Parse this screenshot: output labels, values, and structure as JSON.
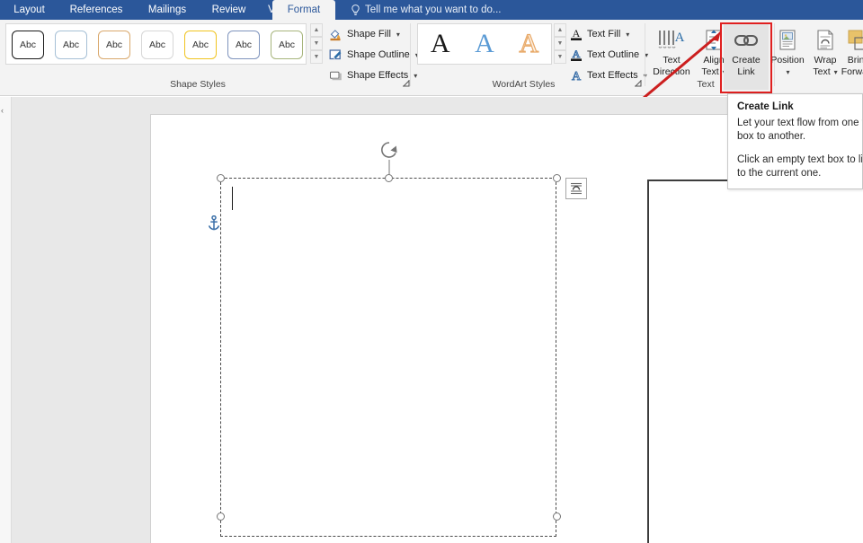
{
  "app": {
    "accent_color": "#2b579a",
    "ribbon_bg": "#f3f3f3",
    "workspace_bg": "#e8e8e8",
    "highlight_color": "#e02020"
  },
  "tabs": [
    {
      "label": "Layout",
      "active": false
    },
    {
      "label": "References",
      "active": false
    },
    {
      "label": "Mailings",
      "active": false
    },
    {
      "label": "Review",
      "active": false
    },
    {
      "label": "View",
      "active": false
    },
    {
      "label": "Format",
      "active": true
    }
  ],
  "tell_me": {
    "placeholder": "Tell me what you want to do...",
    "icon": "lightbulb-icon"
  },
  "groups": [
    {
      "label": "Shape Styles"
    },
    {
      "label": "WordArt Styles"
    },
    {
      "label": "Text"
    }
  ],
  "shape_styles": {
    "gallery_label": "Shape Styles",
    "items": [
      {
        "text": "Abc",
        "border": "#1a1a1a",
        "fill": "#ffffff",
        "selected": true
      },
      {
        "text": "Abc",
        "border": "#a6c0d6",
        "fill": "#ffffff",
        "selected": false
      },
      {
        "text": "Abc",
        "border": "#d9a86c",
        "fill": "#ffffff",
        "selected": false
      },
      {
        "text": "Abc",
        "border": "#d7d7d7",
        "fill": "#ffffff",
        "selected": false
      },
      {
        "text": "Abc",
        "border": "#f0c420",
        "fill": "#ffffff",
        "selected": false
      },
      {
        "text": "Abc",
        "border": "#7f94bd",
        "fill": "#ffffff",
        "selected": false
      },
      {
        "text": "Abc",
        "border": "#a7b57c",
        "fill": "#ffffff",
        "selected": false
      }
    ],
    "scroll_up": "▲",
    "scroll_down": "▼",
    "more": "▼",
    "commands": [
      {
        "label": "Shape Fill",
        "icon": "paint-bucket-icon",
        "has_caret": true
      },
      {
        "label": "Shape Outline",
        "icon": "pen-outline-icon",
        "has_caret": true
      },
      {
        "label": "Shape Effects",
        "icon": "shape-effects-icon",
        "has_caret": true
      }
    ],
    "dialog_launcher": "⬌"
  },
  "wordart_styles": {
    "gallery_label": "WordArt Styles",
    "items": [
      {
        "text": "A",
        "color": "#1a1a1a",
        "style": "filled-dark"
      },
      {
        "text": "A",
        "color": "#5b9bd5",
        "style": "filled-blue"
      },
      {
        "text": "A",
        "color": "#e8b384",
        "style": "outline-peach"
      }
    ],
    "commands": [
      {
        "label": "Text Fill",
        "icon": "text-fill-icon",
        "has_caret": true
      },
      {
        "label": "Text Outline",
        "icon": "text-outline-icon",
        "has_caret": true
      },
      {
        "label": "Text Effects",
        "icon": "text-effects-icon",
        "has_caret": true
      }
    ],
    "dialog_launcher": "⬌"
  },
  "text_group": {
    "label": "Text",
    "buttons": [
      {
        "label_line1": "Text",
        "label_line2": "Direction",
        "icon": "text-direction-icon",
        "has_caret": false,
        "selected": false
      },
      {
        "label_line1": "Align",
        "label_line2": "Text",
        "icon": "align-text-icon",
        "has_caret": true,
        "selected": false
      },
      {
        "label_line1": "Create",
        "label_line2": "Link",
        "icon": "chain-link-icon",
        "has_caret": false,
        "selected": true
      }
    ]
  },
  "arrange_group": {
    "buttons": [
      {
        "label_line1": "Position",
        "label_line2": "",
        "icon": "position-icon",
        "has_caret": true
      },
      {
        "label_line1": "Wrap",
        "label_line2": "Text",
        "icon": "wrap-text-icon",
        "has_caret": true
      },
      {
        "label_line1": "Bring",
        "label_line2": "Forward",
        "icon": "bring-forward-icon",
        "has_caret": true
      }
    ]
  },
  "tooltip": {
    "title": "Create Link",
    "paragraph1": "Let your text flow from one text box to another.",
    "paragraph2": "Click an empty text box to link it to the current one."
  },
  "canvas": {
    "left_rail_icon": "collapse-ribbon-icon",
    "selected_textbox": {
      "name": "selected-text-box",
      "border_style": "dashed",
      "handles": 6,
      "rotation_handle": "rotate-handle-icon",
      "anchor": "object-anchor-icon",
      "layout_options": "layout-options-icon",
      "text_caret_visible": true
    },
    "second_textbox": {
      "name": "target-text-box",
      "border_style": "solid"
    }
  }
}
